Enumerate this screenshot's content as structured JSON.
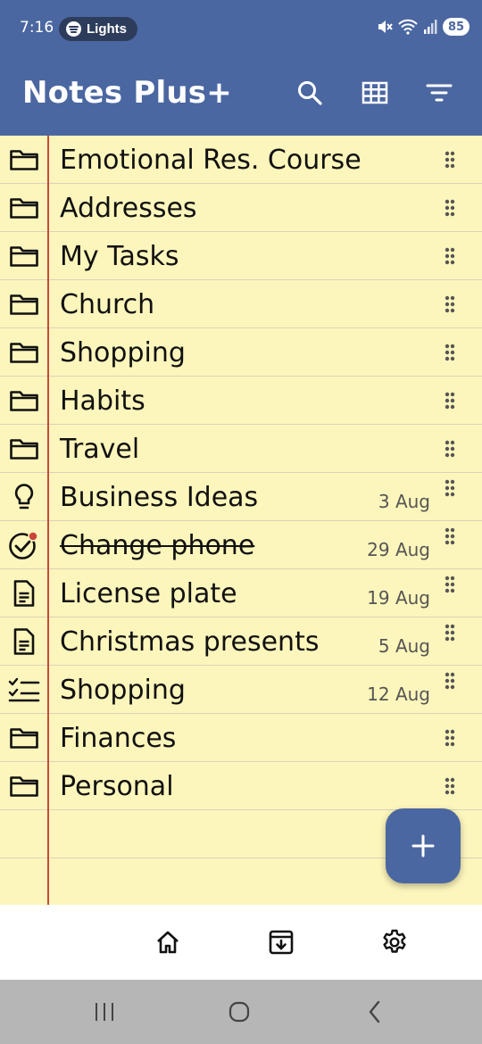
{
  "status_bar": {
    "time": "7:16",
    "media_pill": "Lights",
    "battery": "85"
  },
  "app": {
    "title": "Notes Plus+",
    "accent_color": "#4b67a1",
    "paper_color": "#fdf6bc",
    "margin_color": "#c44a3c"
  },
  "items": [
    {
      "title": "Emotional Res. Course",
      "date": "",
      "icon": "folder-icon",
      "struck": false
    },
    {
      "title": "Addresses",
      "date": "",
      "icon": "folder-icon",
      "struck": false
    },
    {
      "title": "My Tasks",
      "date": "",
      "icon": "folder-icon",
      "struck": false
    },
    {
      "title": "Church",
      "date": "",
      "icon": "folder-icon",
      "struck": false
    },
    {
      "title": "Shopping",
      "date": "",
      "icon": "folder-icon",
      "struck": false
    },
    {
      "title": "Habits",
      "date": "",
      "icon": "folder-icon",
      "struck": false
    },
    {
      "title": "Travel",
      "date": "",
      "icon": "folder-icon",
      "struck": false
    },
    {
      "title": "Business Ideas",
      "date": "3 Aug",
      "icon": "lightbulb-icon",
      "struck": false
    },
    {
      "title": "Change phone",
      "date": "29 Aug",
      "icon": "check-circle-icon",
      "struck": true
    },
    {
      "title": "License plate",
      "date": "19 Aug",
      "icon": "document-icon",
      "struck": false
    },
    {
      "title": "Christmas presents",
      "date": "5 Aug",
      "icon": "document-icon",
      "struck": false
    },
    {
      "title": "Shopping",
      "date": "12 Aug",
      "icon": "checklist-icon",
      "struck": false
    },
    {
      "title": "Finances",
      "date": "",
      "icon": "folder-icon",
      "struck": false
    },
    {
      "title": "Personal",
      "date": "",
      "icon": "folder-icon",
      "struck": false
    }
  ]
}
